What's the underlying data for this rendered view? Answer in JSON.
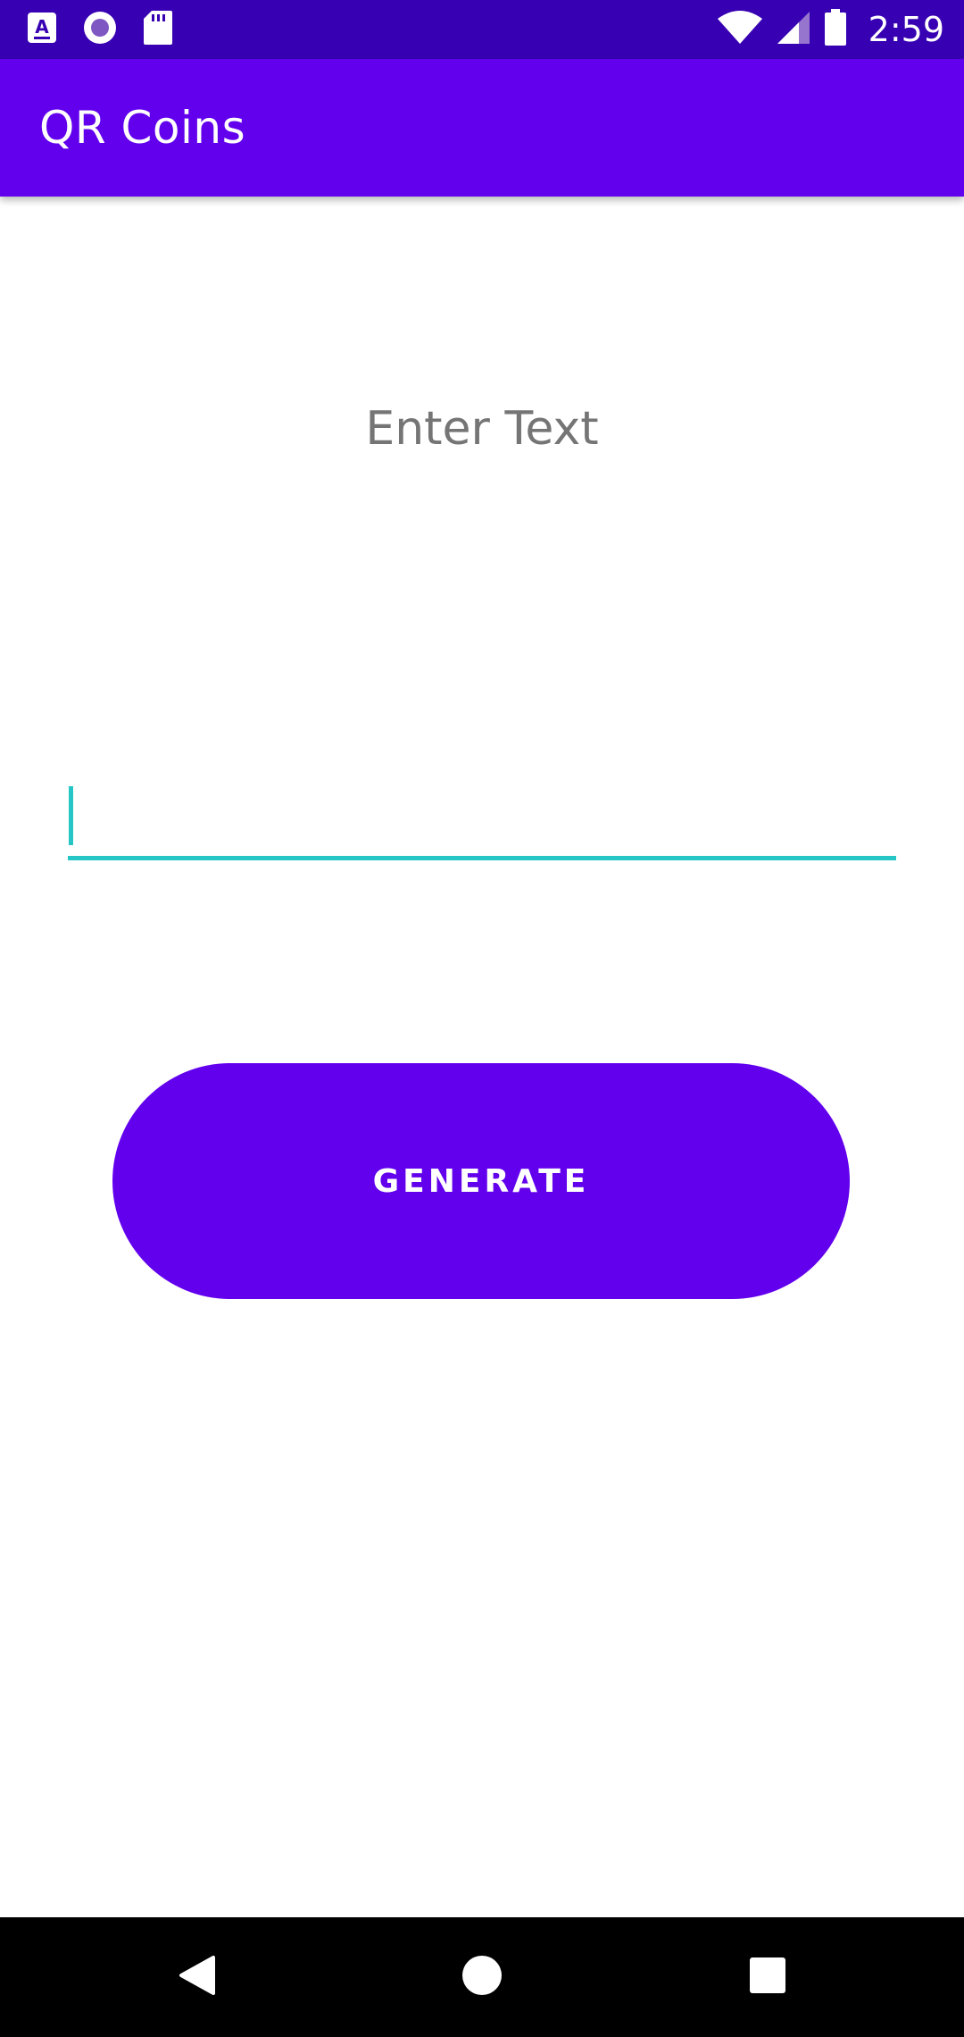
{
  "status_bar": {
    "time": "2:59",
    "icons": [
      "app-a-icon",
      "record-icon",
      "sd-card-icon",
      "wifi-icon",
      "signal-icon",
      "battery-icon"
    ]
  },
  "app_bar": {
    "title": "QR Coins"
  },
  "main": {
    "prompt_label": "Enter Text",
    "text_input_value": "",
    "generate_label": "GENERATE"
  },
  "colors": {
    "status_bar": "#3700b3",
    "primary": "#6200ee",
    "accent": "#26c6c6",
    "label_gray": "#757575"
  },
  "nav_bar": {
    "icons": [
      "back-icon",
      "home-icon",
      "recents-icon"
    ]
  }
}
